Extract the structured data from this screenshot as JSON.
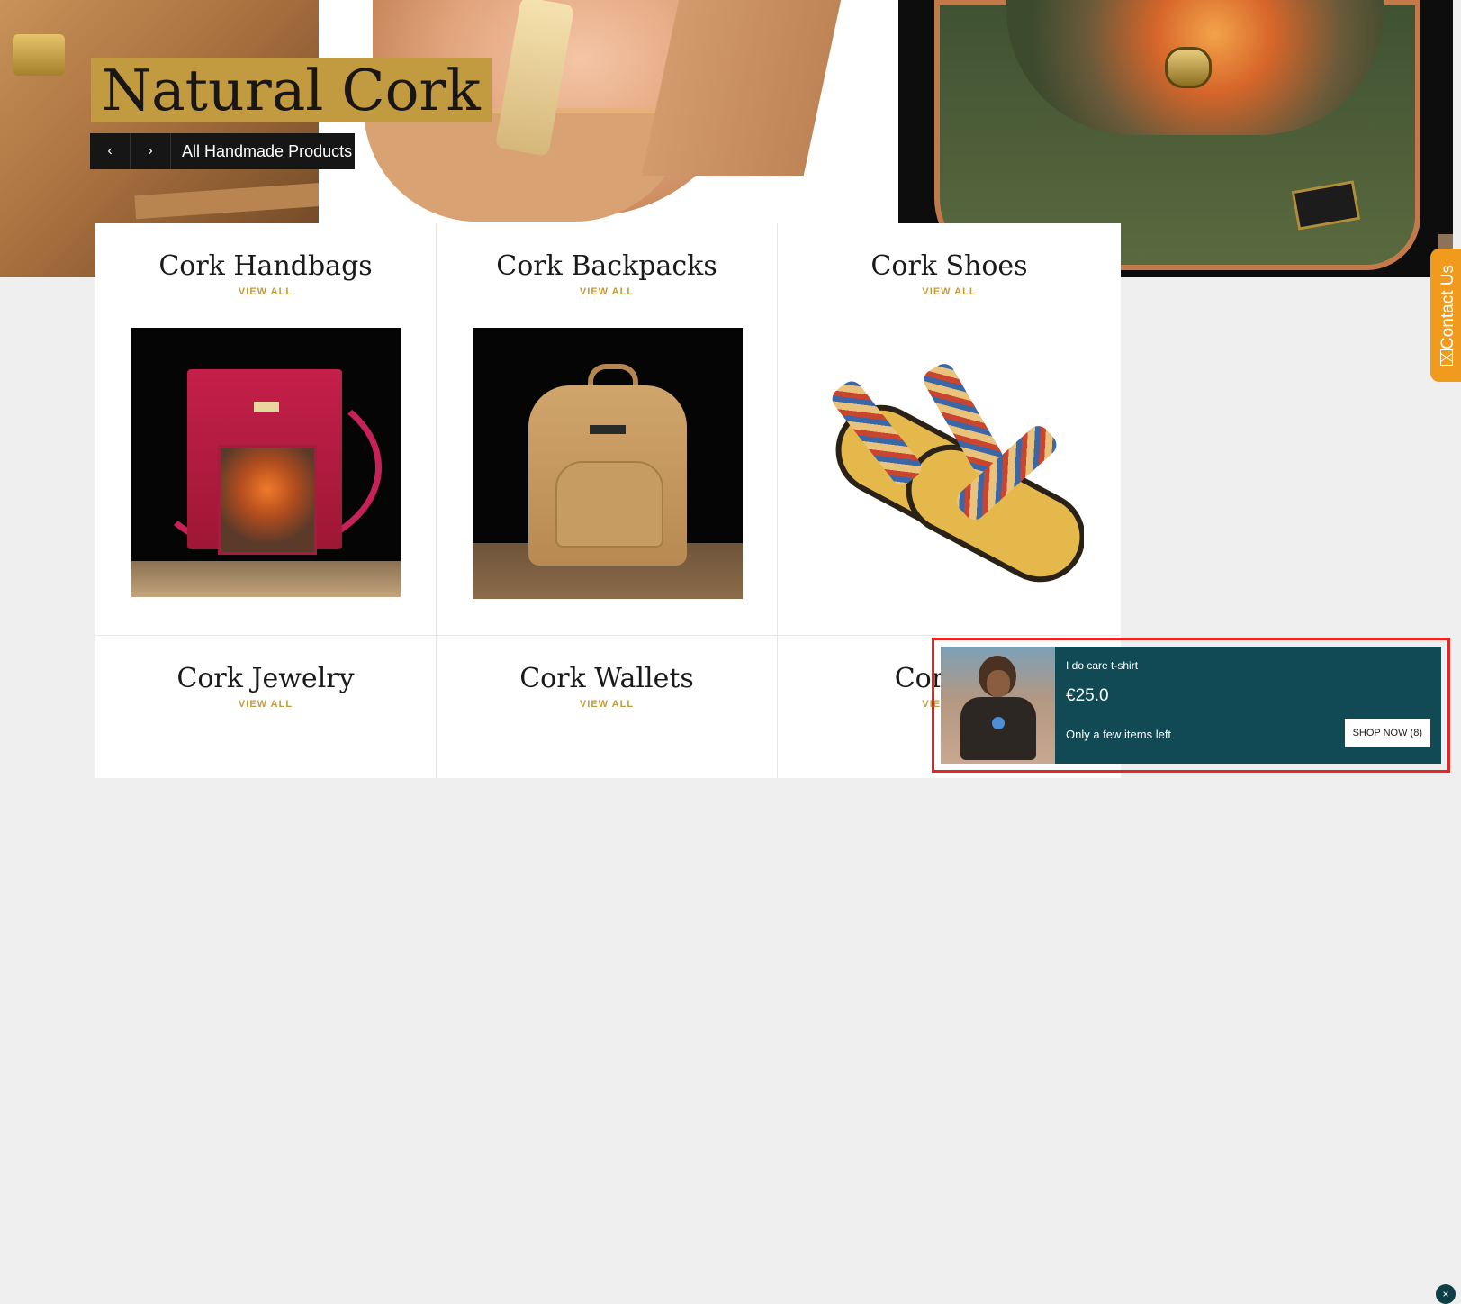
{
  "hero": {
    "title": "Natural Cork",
    "caption": "All Handmade Products",
    "prev_glyph": "‹",
    "next_glyph": "›"
  },
  "collections": [
    {
      "title": "Cork Handbags",
      "link": "VIEW ALL"
    },
    {
      "title": "Cork Backpacks",
      "link": "VIEW ALL"
    },
    {
      "title": "Cork Shoes",
      "link": "VIEW ALL"
    },
    {
      "title": "Cork Jewelry",
      "link": "VIEW ALL"
    },
    {
      "title": "Cork Wallets",
      "link": "VIEW ALL"
    },
    {
      "title": "Cork Ac",
      "link": "VIEW ALL"
    }
  ],
  "contact_tab": {
    "label": "Contact Us"
  },
  "popup": {
    "product": "I do care t-shirt",
    "price": "€25.0",
    "stock": "Only a few items left",
    "cta": "SHOP NOW (8)",
    "close": "×"
  },
  "colors": {
    "accent_gold": "#c29b40",
    "popup_bg": "#114a54",
    "contact_orange": "#f09a1e",
    "highlight_red": "#e32626"
  }
}
